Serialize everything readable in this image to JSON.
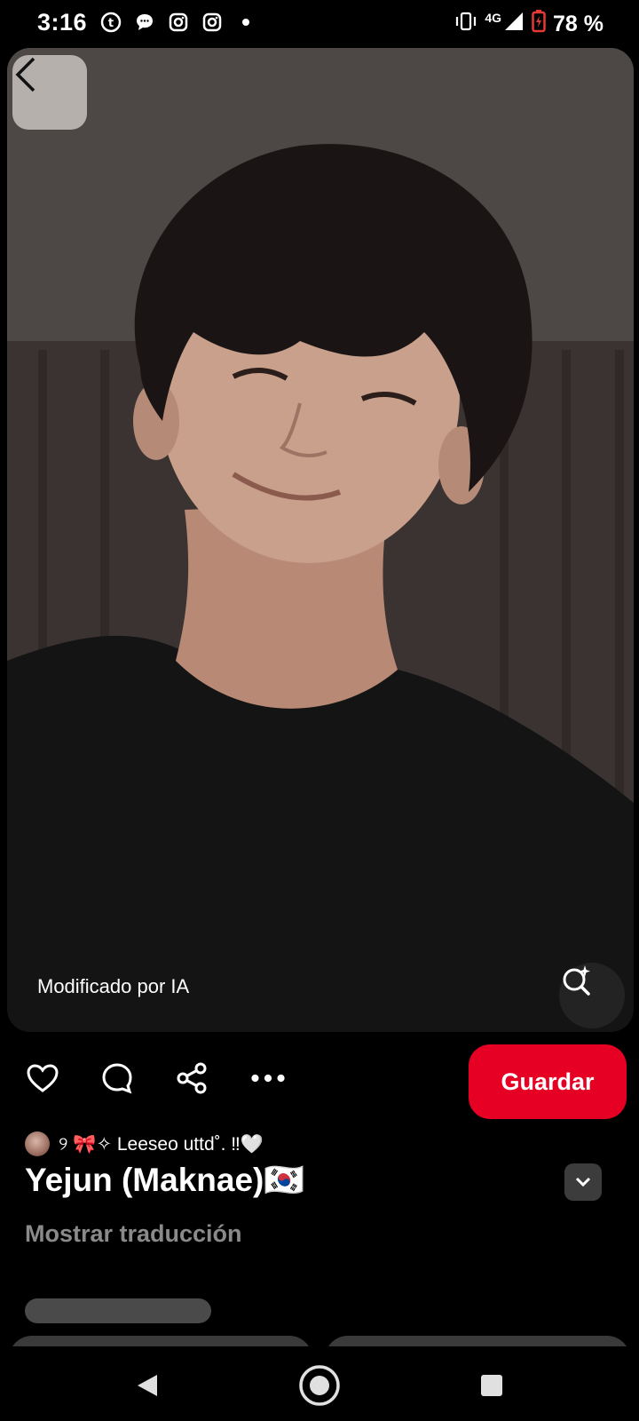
{
  "status_bar": {
    "time": "3:16",
    "network": "4G",
    "battery": "78 %",
    "left_icons": [
      "tumblr-icon",
      "message-icon",
      "instagram-icon",
      "instagram-icon",
      "dot-icon"
    ],
    "right_icons": [
      "vibrate-icon",
      "signal-icon",
      "battery-icon"
    ]
  },
  "photo": {
    "ai_label": "Modificado por IA"
  },
  "actions": {
    "save_label": "Guardar",
    "icons": [
      "heart-icon",
      "comment-icon",
      "share-icon",
      "more-icon"
    ],
    "accent_color": "#e60023"
  },
  "pin": {
    "author": "୨ 🎀✧ Leeseo uttd˚. ‼🤍",
    "title": "Yejun (Maknae)🇰🇷",
    "translate_label": "Mostrar traducción"
  }
}
